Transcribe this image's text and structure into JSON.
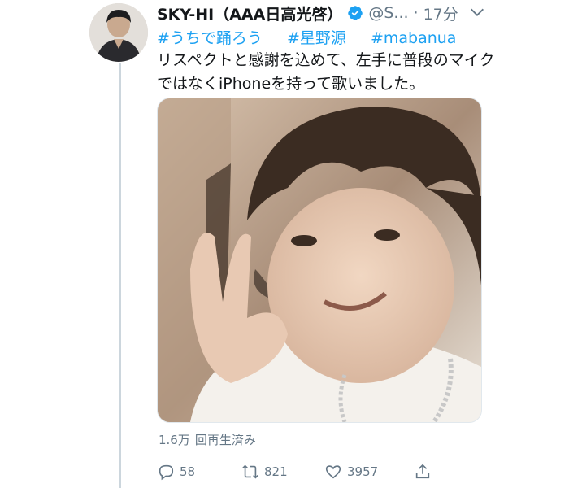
{
  "tweet": {
    "display_name": "SKY-HI（AAA日高光啓）",
    "handle": "@S...",
    "separator": "·",
    "time": "17分",
    "hashtags": [
      "#うちで踊ろう",
      "#星野源",
      "#mabanua"
    ],
    "text": "リスペクトと感謝を込めて、左手に普段のマイクではなくiPhoneを持って歌いました。",
    "views": "1.6万",
    "views_label": "回再生済み",
    "replies": "58",
    "retweets": "821",
    "likes": "3957"
  },
  "icons": {
    "verified": "verified-badge-icon",
    "menu": "chevron-down-icon",
    "reply": "reply-icon",
    "retweet": "retweet-icon",
    "like": "heart-icon",
    "share": "share-icon"
  },
  "colors": {
    "link": "#1da1f2",
    "secondary_text": "#657786",
    "thread_line": "#ccd6dd"
  }
}
